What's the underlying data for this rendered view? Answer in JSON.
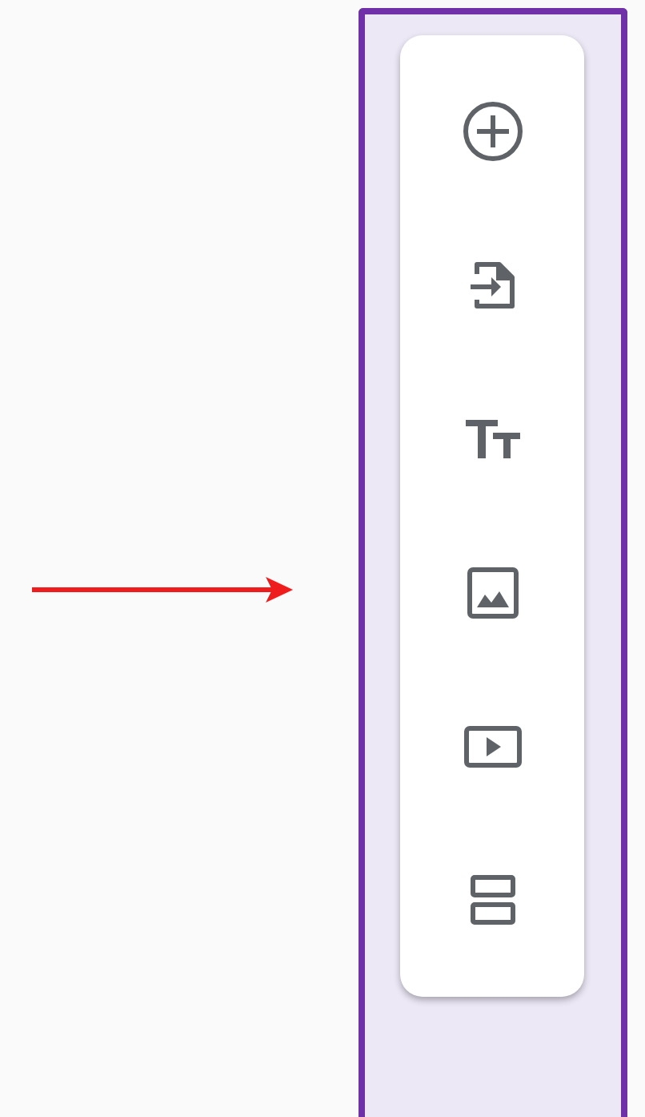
{
  "toolbar": {
    "items": [
      {
        "kind": "add"
      },
      {
        "kind": "import"
      },
      {
        "kind": "title"
      },
      {
        "kind": "image"
      },
      {
        "kind": "video"
      },
      {
        "kind": "section"
      }
    ]
  }
}
